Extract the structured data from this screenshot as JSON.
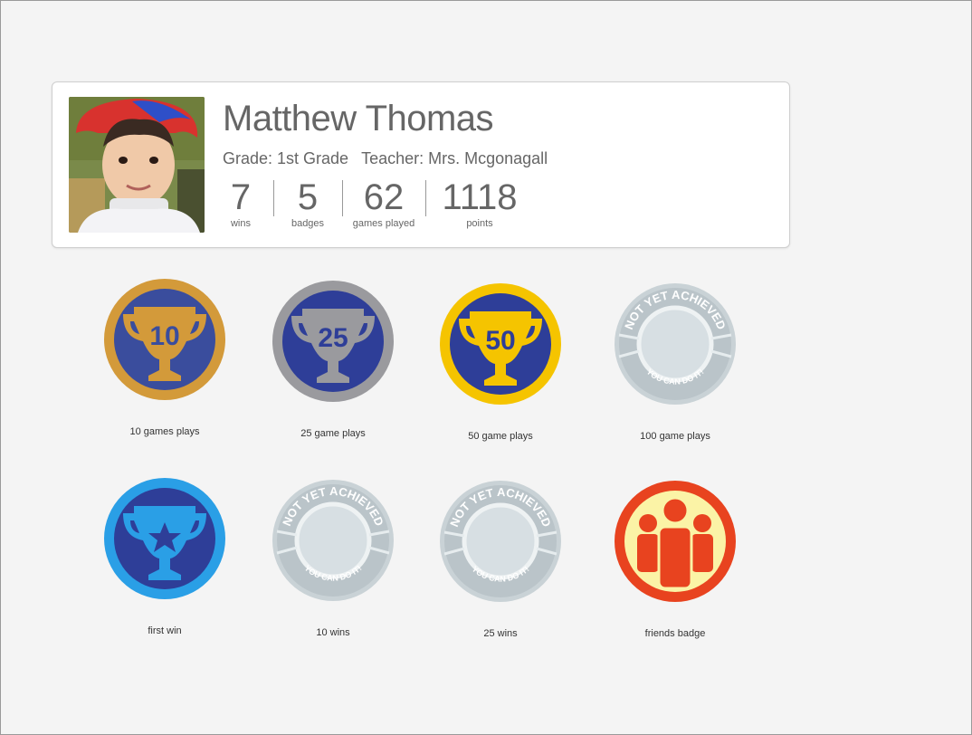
{
  "profile": {
    "name": "Matthew Thomas",
    "grade": "Grade: 1st Grade",
    "teacher": "Teacher: Mrs. Mcgonagall",
    "stats": [
      {
        "value": "7",
        "label": "wins"
      },
      {
        "value": "5",
        "label": "badges"
      },
      {
        "value": "62",
        "label": "games played"
      },
      {
        "value": "1118",
        "label": "points"
      }
    ]
  },
  "badges": [
    {
      "caption": "10 games plays",
      "type": "trophy",
      "text": "10",
      "ring": "#d39a3a",
      "inner": "#3a4d9d",
      "cup": "#d39a3a",
      "textColor": "#3a4d9d"
    },
    {
      "caption": "25 game plays",
      "type": "trophy",
      "text": "25",
      "ring": "#9a9a9e",
      "inner": "#2e3e98",
      "cup": "#9a9a9e",
      "textColor": "#2e3e98"
    },
    {
      "caption": "50 game plays",
      "type": "trophy",
      "text": "50",
      "ring": "#f5c400",
      "inner": "#2e3e98",
      "cup": "#f5c400",
      "textColor": "#2e3e98"
    },
    {
      "caption": "100 game plays",
      "type": "locked",
      "top": "NOT YET ACHIEVED",
      "bottom": "YOU CAN DO IT!"
    },
    {
      "caption": "first win",
      "type": "star",
      "ring": "#2a9fe6",
      "inner": "#2e3e98",
      "cup": "#2a9fe6"
    },
    {
      "caption": "10 wins",
      "type": "locked",
      "top": "NOT YET ACHIEVED",
      "bottom": "YOU CAN DO IT!"
    },
    {
      "caption": "25 wins",
      "type": "locked",
      "top": "NOT YET ACHIEVED",
      "bottom": "YOU CAN DO IT!"
    },
    {
      "caption": "friends badge",
      "type": "friends",
      "ring": "#e8431f",
      "inner": "#fbf3a6",
      "figure": "#e8431f"
    }
  ]
}
